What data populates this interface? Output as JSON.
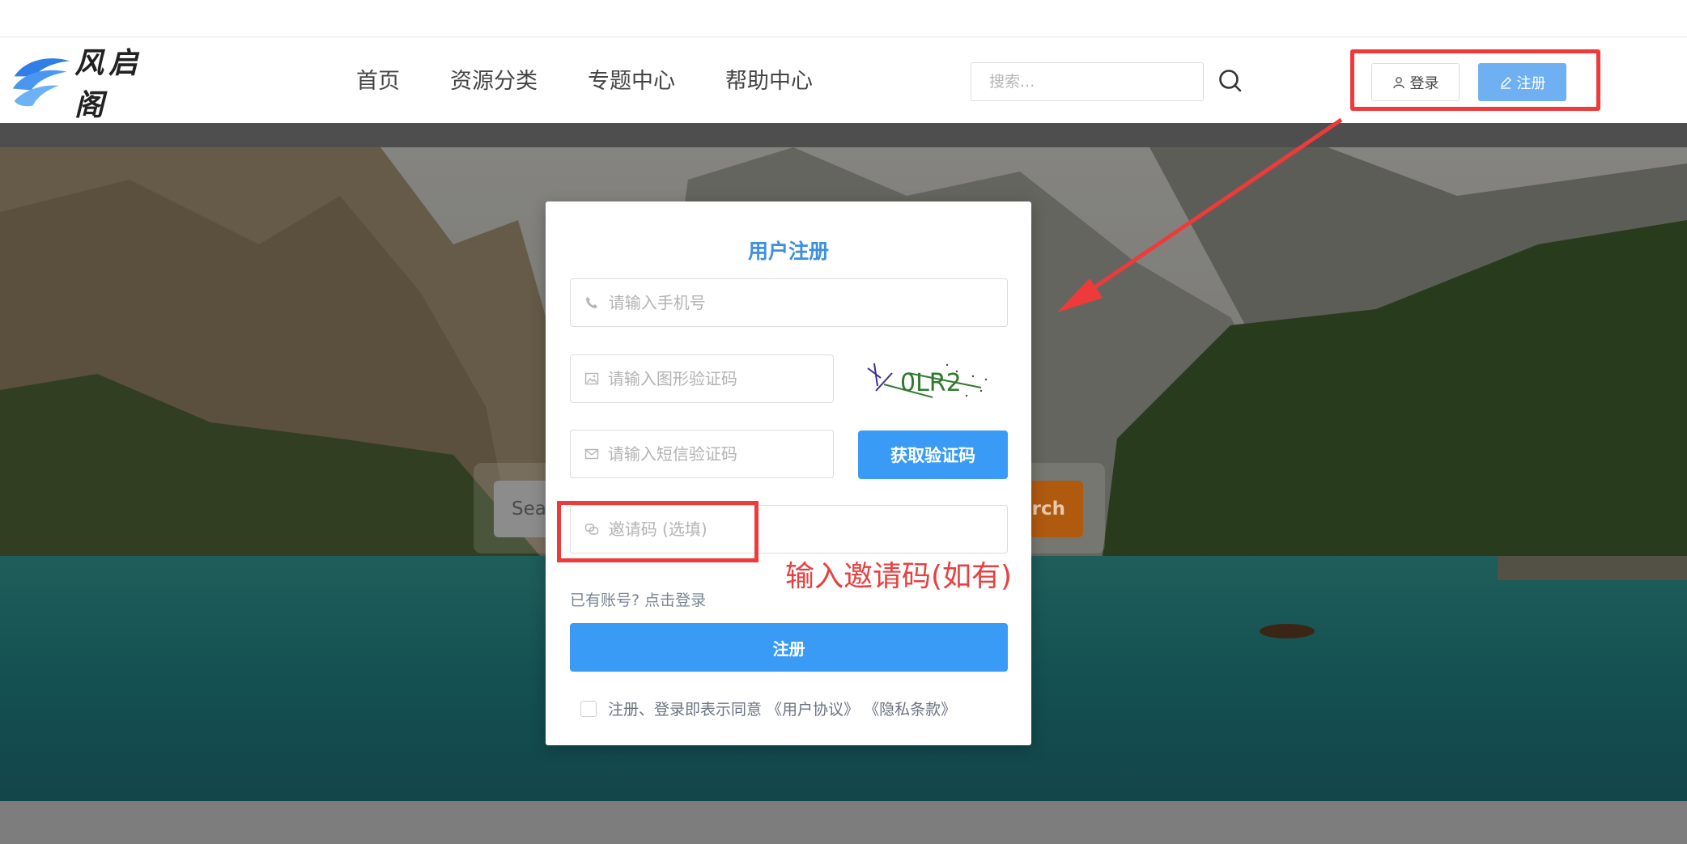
{
  "header": {
    "logo_text": "风启阁",
    "nav": [
      "首页",
      "资源分类",
      "专题中心",
      "帮助中心"
    ],
    "search_placeholder": "搜索...",
    "login_label": "登录",
    "register_label": "注册"
  },
  "hero": {
    "search_text": "Sea",
    "search_button": "arch"
  },
  "modal": {
    "title": "用户注册",
    "phone_placeholder": "请输入手机号",
    "captcha_placeholder": "请输入图形验证码",
    "captcha_code": "0LR2",
    "sms_placeholder": "请输入短信验证码",
    "sms_button": "获取验证码",
    "invite_placeholder": "邀请码 (选填)",
    "login_link": "已有账号? 点击登录",
    "submit_label": "注册",
    "agreement_text": "注册、登录即表示同意 《用户协议》 《隐私条款》"
  },
  "annotation": {
    "text": "输入邀请码(如有)",
    "color": "#e84040"
  },
  "colors": {
    "primary": "#3a9bf7",
    "title": "#3d8fe0",
    "highlight": "#ee3a3a",
    "register_header_btn": "#6fb0f2"
  }
}
